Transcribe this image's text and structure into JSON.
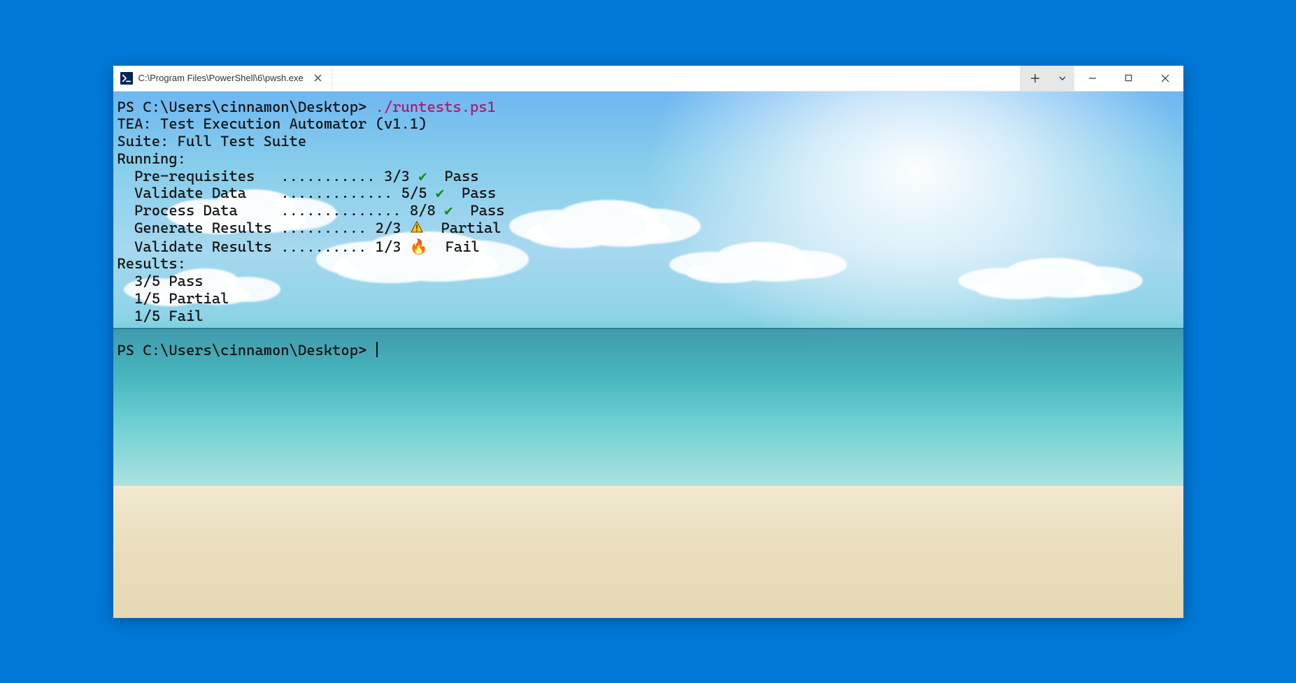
{
  "tab": {
    "title": "C:\\Program Files\\PowerShell\\6\\pwsh.exe",
    "icon_name": "powershell-icon"
  },
  "prompt1": {
    "ps": "PS C:\\Users\\cinnamon\\Desktop> ",
    "command": "./runtests.ps1"
  },
  "output": {
    "header1": "TEA: Test Execution Automator (v1.1)",
    "suite": "Suite: Full Test Suite",
    "running": "Running:",
    "rows": [
      {
        "name": "Pre-requisites",
        "dots": "...........",
        "count": "3/3",
        "status": "pass",
        "statusText": "Pass"
      },
      {
        "name": "Validate Data",
        "dots": ".............",
        "count": "5/5",
        "status": "pass",
        "statusText": "Pass"
      },
      {
        "name": "Process Data",
        "dots": "..............",
        "count": "8/8",
        "status": "pass",
        "statusText": "Pass"
      },
      {
        "name": "Generate Results",
        "dots": "..........",
        "count": "2/3",
        "status": "partial",
        "statusText": "Partial"
      },
      {
        "name": "Validate Results",
        "dots": "..........",
        "count": "1/3",
        "status": "fail",
        "statusText": "Fail"
      }
    ],
    "resultsHeader": "Results:",
    "summary": [
      "3/5 Pass",
      "1/5 Partial",
      "1/5 Fail"
    ]
  },
  "prompt2": {
    "ps": "PS C:\\Users\\cinnamon\\Desktop> "
  },
  "icons": {
    "pass": "✔",
    "partial": "⚠",
    "fail": "🔥"
  }
}
